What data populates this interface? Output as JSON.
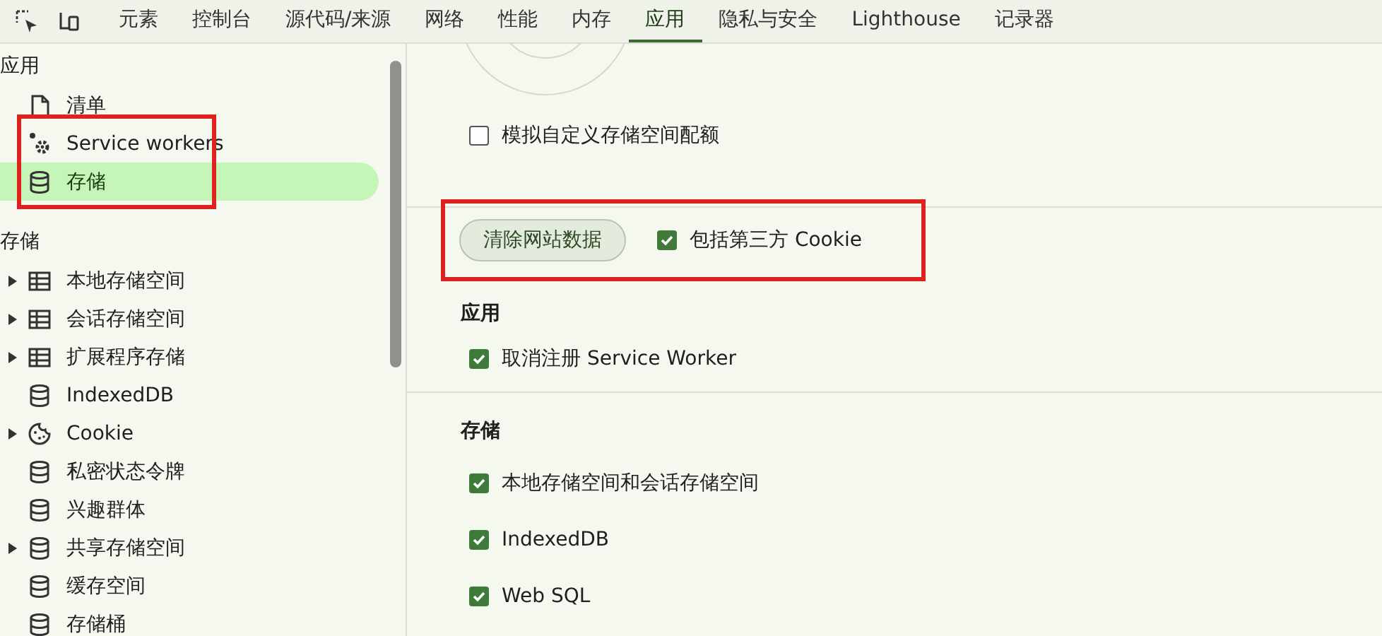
{
  "tabs": [
    {
      "label": "元素",
      "selected": false
    },
    {
      "label": "控制台",
      "selected": false
    },
    {
      "label": "源代码/来源",
      "selected": false
    },
    {
      "label": "网络",
      "selected": false
    },
    {
      "label": "性能",
      "selected": false
    },
    {
      "label": "内存",
      "selected": false
    },
    {
      "label": "应用",
      "selected": true
    },
    {
      "label": "隐私与安全",
      "selected": false
    },
    {
      "label": "Lighthouse",
      "selected": false
    },
    {
      "label": "记录器",
      "selected": false
    }
  ],
  "sidebar": {
    "sections": [
      {
        "title": "应用",
        "items": [
          {
            "label": "清单",
            "kind": "file",
            "expandable": false,
            "selected": false
          },
          {
            "label": "Service workers",
            "kind": "gear",
            "expandable": false,
            "selected": false,
            "annotated": true
          },
          {
            "label": "存储",
            "kind": "db",
            "expandable": false,
            "selected": true,
            "annotated": true
          }
        ]
      },
      {
        "title": "存储",
        "items": [
          {
            "label": "本地存储空间",
            "kind": "table",
            "expandable": true,
            "selected": false
          },
          {
            "label": "会话存储空间",
            "kind": "table",
            "expandable": true,
            "selected": false
          },
          {
            "label": "扩展程序存储",
            "kind": "table",
            "expandable": true,
            "selected": false
          },
          {
            "label": "IndexedDB",
            "kind": "db",
            "expandable": false,
            "selected": false
          },
          {
            "label": "Cookie",
            "kind": "cookie",
            "expandable": true,
            "selected": false
          },
          {
            "label": "私密状态令牌",
            "kind": "db",
            "expandable": false,
            "selected": false
          },
          {
            "label": "兴趣群体",
            "kind": "db",
            "expandable": false,
            "selected": false
          },
          {
            "label": "共享存储空间",
            "kind": "db",
            "expandable": true,
            "selected": false
          },
          {
            "label": "缓存空间",
            "kind": "db",
            "expandable": false,
            "selected": false
          },
          {
            "label": "存储桶",
            "kind": "db",
            "expandable": false,
            "selected": false
          }
        ]
      }
    ]
  },
  "main": {
    "quota_option": {
      "label": "模拟自定义存储空间配额",
      "checked": false
    },
    "clear_row": {
      "button": "清除网站数据",
      "option": {
        "label": "包括第三方 Cookie",
        "checked": true
      },
      "annotated": true
    },
    "groups": [
      {
        "title": "应用",
        "options": [
          {
            "label": "取消注册 Service Worker",
            "checked": true
          }
        ]
      },
      {
        "title": "存储",
        "options": [
          {
            "label": "本地存储空间和会话存储空间",
            "checked": true
          },
          {
            "label": "IndexedDB",
            "checked": true
          },
          {
            "label": "Web SQL",
            "checked": true
          }
        ]
      }
    ]
  }
}
